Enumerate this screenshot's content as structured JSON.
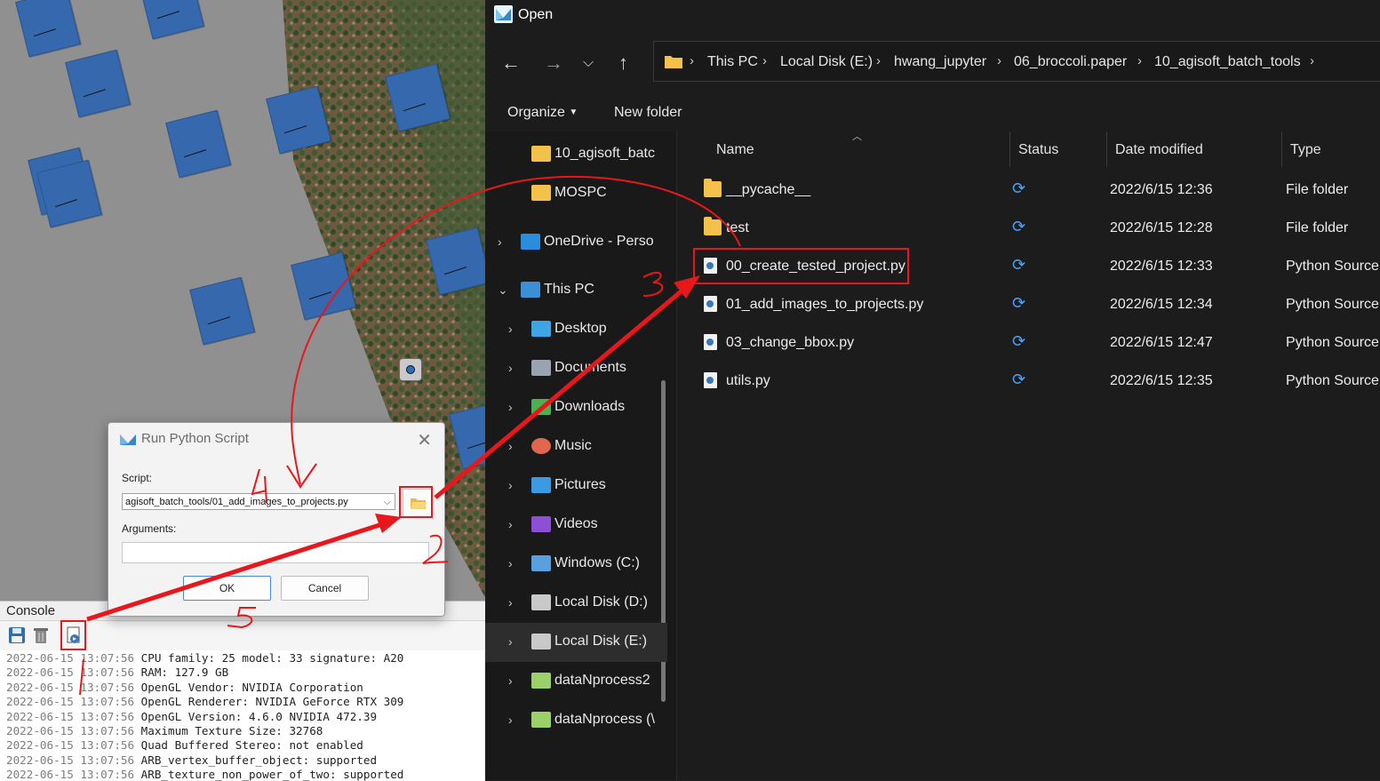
{
  "viewport": {
    "accent_blue": "#3668ad"
  },
  "console": {
    "title": "Console",
    "toolbar": [
      "save-icon",
      "clear-icon",
      "run-script-icon"
    ],
    "lines": [
      {
        "ts": "2022-06-15 13:07:56",
        "msg": "CPU family: 25 model: 33 signature: A20"
      },
      {
        "ts": "2022-06-15 13:07:56",
        "msg": "RAM: 127.9 GB"
      },
      {
        "ts": "2022-06-15 13:07:56",
        "msg": "OpenGL Vendor: NVIDIA Corporation"
      },
      {
        "ts": "2022-06-15 13:07:56",
        "msg": "OpenGL Renderer: NVIDIA GeForce RTX 309"
      },
      {
        "ts": "2022-06-15 13:07:56",
        "msg": "OpenGL Version: 4.6.0 NVIDIA 472.39"
      },
      {
        "ts": "2022-06-15 13:07:56",
        "msg": "Maximum Texture Size: 32768"
      },
      {
        "ts": "2022-06-15 13:07:56",
        "msg": "Quad Buffered Stereo: not enabled"
      },
      {
        "ts": "2022-06-15 13:07:56",
        "msg": "ARB_vertex_buffer_object: supported"
      },
      {
        "ts": "2022-06-15 13:07:56",
        "msg": "ARB_texture_non_power_of_two: supported"
      }
    ]
  },
  "run_dialog": {
    "title": "Run Python Script",
    "script_label": "Script:",
    "script_value": "agisoft_batch_tools/01_add_images_to_projects.py",
    "arguments_label": "Arguments:",
    "arguments_value": "",
    "ok_label": "OK",
    "cancel_label": "Cancel"
  },
  "explorer": {
    "title": "Open",
    "breadcrumb": [
      "This PC",
      "Local Disk (E:)",
      "hwang_jupyter",
      "06_broccoli.paper",
      "10_agisoft_batch_tools"
    ],
    "organize_label": "Organize",
    "new_folder_label": "New folder",
    "nav": [
      {
        "label": "10_agisoft_batc",
        "icon": "folder-icon",
        "chevron": ""
      },
      {
        "label": "MOSPC",
        "icon": "folder-icon",
        "chevron": ""
      },
      {
        "label": "OneDrive - Perso",
        "icon": "cloud-icon",
        "chevron": "›"
      },
      {
        "label": "This PC",
        "icon": "pc-icon",
        "chevron": "⌄"
      },
      {
        "label": "Desktop",
        "icon": "desktop-icon",
        "chevron": "›"
      },
      {
        "label": "Documents",
        "icon": "documents-icon",
        "chevron": "›"
      },
      {
        "label": "Downloads",
        "icon": "downloads-icon",
        "chevron": "›"
      },
      {
        "label": "Music",
        "icon": "music-icon",
        "chevron": "›"
      },
      {
        "label": "Pictures",
        "icon": "pictures-icon",
        "chevron": "›"
      },
      {
        "label": "Videos",
        "icon": "videos-icon",
        "chevron": "›"
      },
      {
        "label": "Windows (C:)",
        "icon": "drive-c-icon",
        "chevron": "›"
      },
      {
        "label": "Local Disk (D:)",
        "icon": "drive-icon",
        "chevron": "›"
      },
      {
        "label": "Local Disk (E:)",
        "icon": "drive-icon",
        "chevron": "›"
      },
      {
        "label": "dataNprocess2",
        "icon": "network-drive-icon",
        "chevron": "›"
      },
      {
        "label": "dataNprocess (\\",
        "icon": "network-drive-icon",
        "chevron": "›"
      }
    ],
    "columns": {
      "name": "Name",
      "status": "Status",
      "date": "Date modified",
      "type": "Type"
    },
    "files": [
      {
        "name": "__pycache__",
        "kind": "folder",
        "status": "sync-icon",
        "date": "2022/6/15 12:36",
        "type": "File folder"
      },
      {
        "name": "test",
        "kind": "folder",
        "status": "sync-icon",
        "date": "2022/6/15 12:28",
        "type": "File folder"
      },
      {
        "name": "00_create_tested_project.py",
        "kind": "py",
        "status": "sync-icon",
        "date": "2022/6/15 12:33",
        "type": "Python Source"
      },
      {
        "name": "01_add_images_to_projects.py",
        "kind": "py",
        "status": "sync-icon",
        "date": "2022/6/15 12:34",
        "type": "Python Source"
      },
      {
        "name": "03_change_bbox.py",
        "kind": "py",
        "status": "sync-icon",
        "date": "2022/6/15 12:47",
        "type": "Python Source"
      },
      {
        "name": "utils.py",
        "kind": "py",
        "status": "sync-icon",
        "date": "2022/6/15 12:35",
        "type": "Python Source"
      }
    ]
  },
  "annotations": {
    "color": "#e8171c",
    "step_numbers": [
      "1",
      "2",
      "3",
      "4",
      "5"
    ]
  }
}
